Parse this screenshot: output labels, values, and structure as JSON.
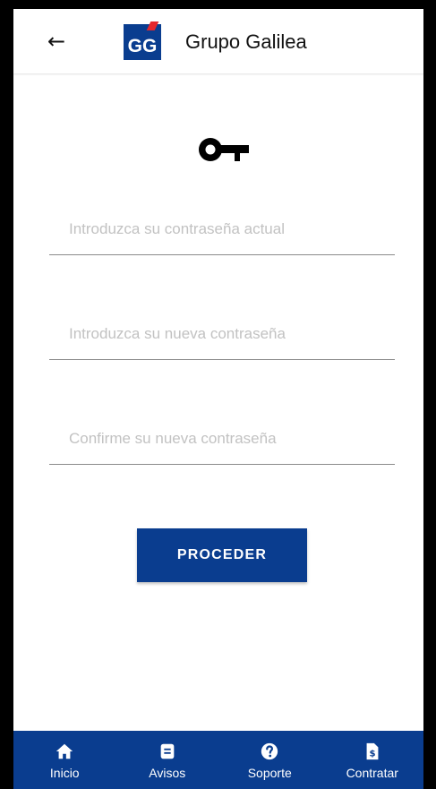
{
  "header": {
    "back_icon": "arrow-left-icon",
    "logo_text": "GG",
    "title": "Grupo Galilea"
  },
  "form": {
    "icon": "key-icon",
    "current_password_placeholder": "Introduzca su contraseña actual",
    "new_password_placeholder": "Introduzca su nueva contraseña",
    "confirm_password_placeholder": "Confirme su nueva contraseña",
    "submit_label": "PROCEDER"
  },
  "bottom_nav": {
    "items": [
      {
        "label": "Inicio",
        "icon": "home-icon"
      },
      {
        "label": "Avisos",
        "icon": "document-icon"
      },
      {
        "label": "Soporte",
        "icon": "help-icon"
      },
      {
        "label": "Contratar",
        "icon": "contract-icon"
      }
    ]
  },
  "colors": {
    "brand": "#0a3d8f",
    "logo_accent": "#e4262c",
    "placeholder": "#c2c2c2"
  }
}
